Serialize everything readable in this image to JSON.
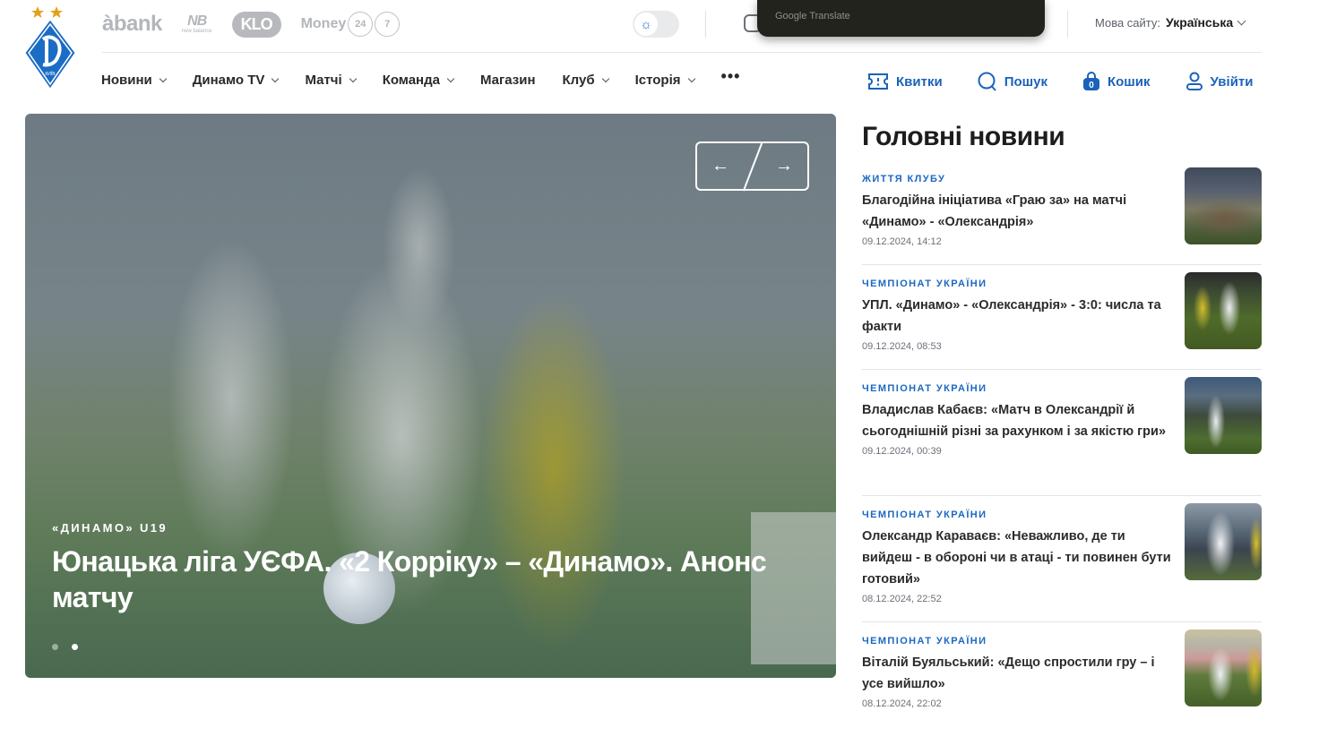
{
  "header": {
    "logo_alt": "Динамо Київ",
    "logo_caption": "КИЇВ",
    "sponsors": [
      {
        "name": "abank",
        "label": "àbank"
      },
      {
        "name": "new-balance",
        "label": "NB",
        "sub": "new balance"
      },
      {
        "name": "klo",
        "label": "KLO"
      },
      {
        "name": "money24-7",
        "label": "Money",
        "n1": "24",
        "n2": "7"
      }
    ],
    "theme_toggle": "light",
    "google_translate_label": "Google Translate",
    "language": {
      "label": "Мова сайту:",
      "value": "Українська"
    }
  },
  "nav": {
    "items": [
      {
        "label": "Новини",
        "dropdown": true
      },
      {
        "label": "Динамо TV",
        "dropdown": true
      },
      {
        "label": "Матчі",
        "dropdown": true
      },
      {
        "label": "Команда",
        "dropdown": true
      },
      {
        "label": "Магазин",
        "dropdown": false
      },
      {
        "label": "Клуб",
        "dropdown": true
      },
      {
        "label": "Історія",
        "dropdown": true
      }
    ],
    "more": "•••",
    "actions": {
      "tickets": "Квитки",
      "search": "Пошук",
      "cart": "Кошик",
      "cart_count": "0",
      "login": "Увійти"
    }
  },
  "hero": {
    "tag": "«ДИНАМО» U19",
    "title": "Юнацька ліга УЄФА. «2 Корріку» – «Динамо». Анонс матчу",
    "prev_arrow": "←",
    "next_arrow": "→",
    "slides_total": 2,
    "active_slide": 2
  },
  "sidebar": {
    "title": "Головні новини",
    "news": [
      {
        "category": "ЖИТТЯ КЛУБУ",
        "title": "Благодійна ініціатива «Граю за» на матчі «Динамо» - «Олександрія»",
        "date": "09.12.2024, 14:12"
      },
      {
        "category": "ЧЕМПІОНАТ УКРАЇНИ",
        "title": "УПЛ. «Динамо» - «Олександрія» - 3:0: числа та факти",
        "date": "09.12.2024, 08:53"
      },
      {
        "category": "ЧЕМПІОНАТ УКРАЇНИ",
        "title": "Владислав Кабаєв: «Матч в Олександрії й сьогоднішній різні за рахунком і за якістю гри»",
        "date": "09.12.2024, 00:39"
      },
      {
        "category": "ЧЕМПІОНАТ УКРАЇНИ",
        "title": "Олександр Караваєв: «Неважливо, де ти вийдеш - в обороні чи в атаці - ти повинен бути готовий»",
        "date": "08.12.2024, 22:52"
      },
      {
        "category": "ЧЕМПІОНАТ УКРАЇНИ",
        "title": "Віталій Буяльський: «Дещо спростили гру – і усе вийшло»",
        "date": "08.12.2024, 22:02"
      }
    ]
  },
  "colors": {
    "accent": "#1b63b8",
    "logo_blue": "#1a6cc4",
    "star": "#e0a21b"
  }
}
